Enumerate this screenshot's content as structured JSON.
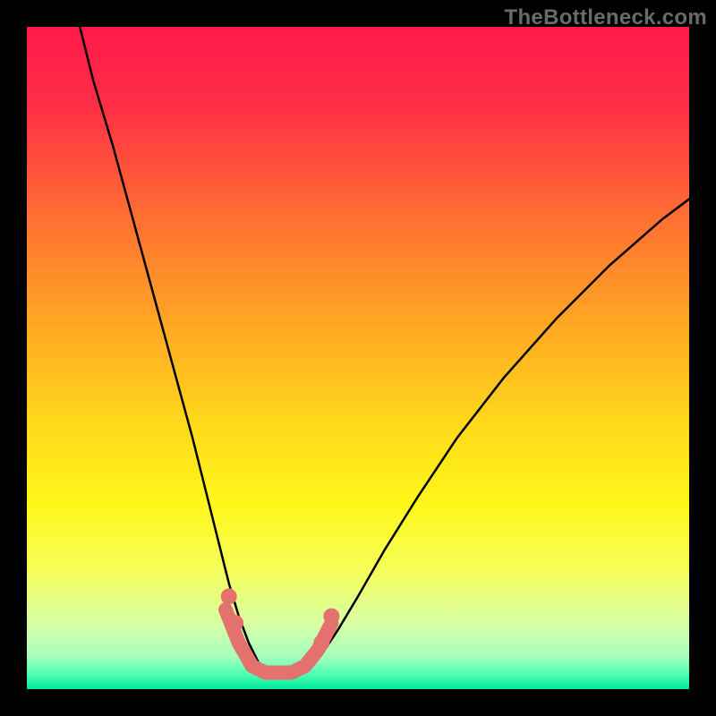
{
  "watermark": "TheBottleneck.com",
  "chart_data": {
    "type": "line",
    "title": "",
    "xlabel": "",
    "ylabel": "",
    "xlim": [
      0,
      100
    ],
    "ylim": [
      0,
      100
    ],
    "grid": false,
    "legend": false,
    "gradient_stops": [
      {
        "pos": 0.0,
        "color": "#ff1a4b"
      },
      {
        "pos": 0.12,
        "color": "#ff2e46"
      },
      {
        "pos": 0.28,
        "color": "#ff6c33"
      },
      {
        "pos": 0.44,
        "color": "#ffa424"
      },
      {
        "pos": 0.6,
        "color": "#ffd91a"
      },
      {
        "pos": 0.72,
        "color": "#fff71a"
      },
      {
        "pos": 0.82,
        "color": "#f5ff5a"
      },
      {
        "pos": 0.9,
        "color": "#d9ffa3"
      },
      {
        "pos": 0.95,
        "color": "#a8ffc0"
      },
      {
        "pos": 0.98,
        "color": "#46ffb0"
      },
      {
        "pos": 1.0,
        "color": "#00e69c"
      }
    ],
    "series": [
      {
        "name": "bottleneck-curve-left",
        "type": "line",
        "color": "#000000",
        "x": [
          8,
          10,
          13,
          16,
          19,
          22,
          25,
          27,
          29,
          30.5,
          32,
          33.5,
          35,
          36
        ],
        "y": [
          100,
          92,
          82,
          71,
          60,
          49,
          38,
          30,
          22,
          16,
          11,
          7,
          4,
          3
        ]
      },
      {
        "name": "bottleneck-curve-right",
        "type": "line",
        "color": "#000000",
        "x": [
          42,
          43.5,
          45,
          47,
          50,
          54,
          59,
          65,
          72,
          80,
          88,
          96,
          100
        ],
        "y": [
          3,
          4,
          6,
          9,
          14,
          21,
          29,
          38,
          47,
          56,
          64,
          71,
          74
        ]
      },
      {
        "name": "valley-floor",
        "type": "line",
        "color": "#e3716e",
        "note": "thicker muted-red segment along floor and lower curve walls",
        "x": [
          30,
          32,
          34,
          36,
          38,
          40,
          42,
          44,
          46
        ],
        "y": [
          12,
          7,
          3.5,
          2.5,
          2.5,
          2.5,
          3.5,
          6,
          10
        ]
      },
      {
        "name": "valley-dots",
        "type": "scatter",
        "color": "#e3716e",
        "x": [
          30.5,
          31.5,
          44.5,
          46
        ],
        "y": [
          14,
          10,
          7,
          11
        ]
      }
    ]
  }
}
